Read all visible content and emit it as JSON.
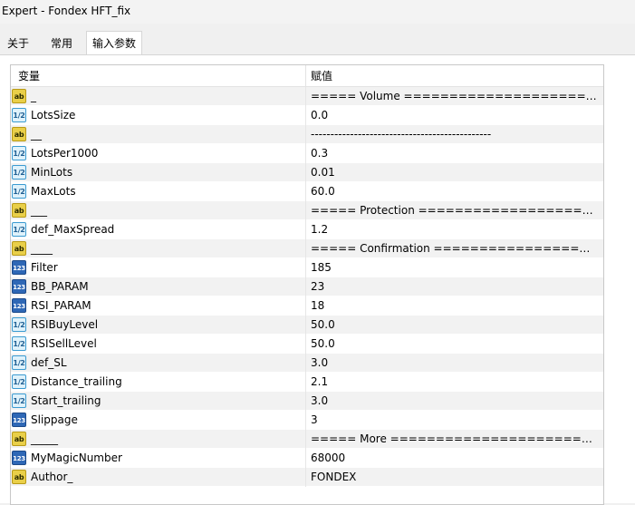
{
  "window": {
    "title": "Expert - Fondex HFT_fix"
  },
  "tabs": [
    {
      "label": "关于",
      "active": false
    },
    {
      "label": "常用",
      "active": false
    },
    {
      "label": "输入参数",
      "active": true
    }
  ],
  "grid": {
    "headers": {
      "name": "变量",
      "value": "赋值"
    },
    "type_icons": {
      "string": "ab",
      "double": "1/2",
      "int": "123"
    },
    "rows": [
      {
        "type": "string",
        "name": "_",
        "value": "===== Volume =================================="
      },
      {
        "type": "double",
        "name": "LotsSize",
        "value": "0.0"
      },
      {
        "type": "string",
        "name": "__",
        "value": "----------------------------------------------"
      },
      {
        "type": "double",
        "name": "LotsPer1000",
        "value": "0.3"
      },
      {
        "type": "double",
        "name": "MinLots",
        "value": "0.01"
      },
      {
        "type": "double",
        "name": "MaxLots",
        "value": "60.0"
      },
      {
        "type": "string",
        "name": "___",
        "value": "===== Protection =============================="
      },
      {
        "type": "double",
        "name": "def_MaxSpread",
        "value": "1.2"
      },
      {
        "type": "string",
        "name": "____",
        "value": "===== Confirmation ============================"
      },
      {
        "type": "int",
        "name": "Filter",
        "value": "185"
      },
      {
        "type": "int",
        "name": "BB_PARAM",
        "value": "23"
      },
      {
        "type": "int",
        "name": "RSI_PARAM",
        "value": "18"
      },
      {
        "type": "double",
        "name": "RSIBuyLevel",
        "value": "50.0"
      },
      {
        "type": "double",
        "name": "RSISellLevel",
        "value": "50.0"
      },
      {
        "type": "double",
        "name": "def_SL",
        "value": "3.0"
      },
      {
        "type": "double",
        "name": "Distance_trailing",
        "value": "2.1"
      },
      {
        "type": "double",
        "name": "Start_trailing",
        "value": "3.0"
      },
      {
        "type": "int",
        "name": "Slippage",
        "value": "3"
      },
      {
        "type": "string",
        "name": "_____",
        "value": "===== More ===================================="
      },
      {
        "type": "int",
        "name": "MyMagicNumber",
        "value": "68000"
      },
      {
        "type": "string",
        "name": "Author_",
        "value": "FONDEX"
      }
    ]
  }
}
